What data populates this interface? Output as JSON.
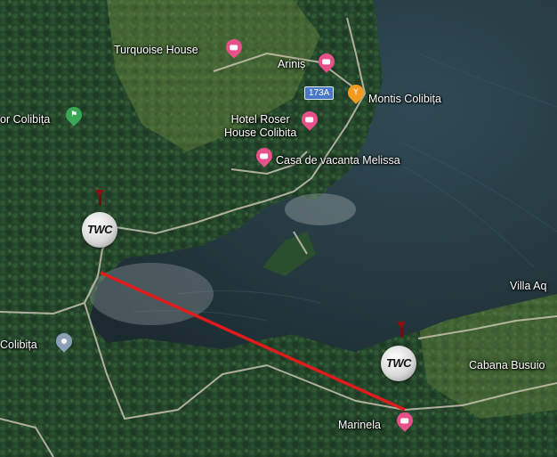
{
  "map": {
    "places": [
      {
        "id": "turquoise-house",
        "label": "Turquoise House",
        "kind": "hotel"
      },
      {
        "id": "arinis",
        "label": "Ariniș",
        "kind": "hotel"
      },
      {
        "id": "montis",
        "label": "Montis Colibița",
        "kind": "restaurant"
      },
      {
        "id": "hotel-roser",
        "label": "Hotel Roser\nHouse Colibita",
        "kind": "hotel"
      },
      {
        "id": "casa-melissa",
        "label": "Casa de vacanta Melissa",
        "kind": "hotel"
      },
      {
        "id": "tor-colibita",
        "label": "or Colibița",
        "kind": "hiking"
      },
      {
        "id": "colibita-west",
        "label": "Colibița",
        "kind": "place"
      },
      {
        "id": "villa-aq",
        "label": "Villa Aq",
        "kind": "text"
      },
      {
        "id": "cabana-busuio",
        "label": "Cabana Busuio",
        "kind": "text"
      },
      {
        "id": "marinela",
        "label": "Marinela",
        "kind": "hotel"
      }
    ],
    "road_badge": "173A",
    "zipline_marker_text": "TWC",
    "colors": {
      "hotel_pin": "#e8508a",
      "restaurant_pin": "#f29a1f",
      "hiking_pin": "#3aa757",
      "place_pin": "#8aa0b8",
      "zipline_line": "#e01b1b",
      "road_badge": "#4a78c8"
    }
  }
}
